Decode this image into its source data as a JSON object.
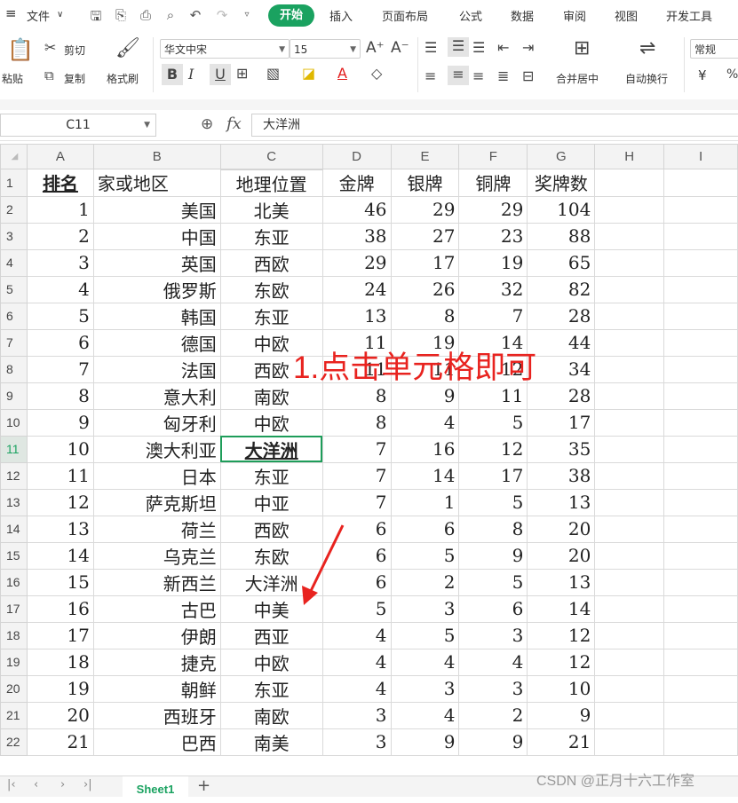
{
  "menubar": {
    "file_label": "文件",
    "tabs": [
      "开始",
      "插入",
      "页面布局",
      "公式",
      "数据",
      "审阅",
      "视图",
      "开发工具"
    ]
  },
  "ribbon": {
    "paste": "粘贴",
    "cut": "剪切",
    "copy": "复制",
    "format_painter": "格式刷",
    "font_name": "华文中宋",
    "font_size": "15",
    "merge_center": "合并居中",
    "wrap_text": "自动换行",
    "number_format": "常规",
    "currency_symbol": "¥"
  },
  "formula_bar": {
    "cell_ref": "C11",
    "fx_label": "fx",
    "value": "大洋洲"
  },
  "grid": {
    "columns": [
      "A",
      "B",
      "C",
      "D",
      "E",
      "F",
      "G",
      "H",
      "I"
    ],
    "header_row": [
      "排名",
      "家或地区",
      "地理位置",
      "金牌",
      "银牌",
      "铜牌",
      "奖牌数"
    ],
    "rows": [
      [
        "1",
        "美国",
        "北美",
        "46",
        "29",
        "29",
        "104"
      ],
      [
        "2",
        "中国",
        "东亚",
        "38",
        "27",
        "23",
        "88"
      ],
      [
        "3",
        "英国",
        "西欧",
        "29",
        "17",
        "19",
        "65"
      ],
      [
        "4",
        "俄罗斯",
        "东欧",
        "24",
        "26",
        "32",
        "82"
      ],
      [
        "5",
        "韩国",
        "东亚",
        "13",
        "8",
        "7",
        "28"
      ],
      [
        "6",
        "德国",
        "中欧",
        "11",
        "19",
        "14",
        "44"
      ],
      [
        "7",
        "法国",
        "西欧",
        "11",
        "11",
        "12",
        "34"
      ],
      [
        "8",
        "意大利",
        "南欧",
        "8",
        "9",
        "11",
        "28"
      ],
      [
        "9",
        "匈牙利",
        "中欧",
        "8",
        "4",
        "5",
        "17"
      ],
      [
        "10",
        "澳大利亚",
        "大洋洲",
        "7",
        "16",
        "12",
        "35"
      ],
      [
        "11",
        "日本",
        "东亚",
        "7",
        "14",
        "17",
        "38"
      ],
      [
        "12",
        "萨克斯坦",
        "中亚",
        "7",
        "1",
        "5",
        "13"
      ],
      [
        "13",
        "荷兰",
        "西欧",
        "6",
        "6",
        "8",
        "20"
      ],
      [
        "14",
        "乌克兰",
        "东欧",
        "6",
        "5",
        "9",
        "20"
      ],
      [
        "15",
        "新西兰",
        "大洋洲",
        "6",
        "2",
        "5",
        "13"
      ],
      [
        "16",
        "古巴",
        "中美",
        "5",
        "3",
        "6",
        "14"
      ],
      [
        "17",
        "伊朗",
        "西亚",
        "4",
        "5",
        "3",
        "12"
      ],
      [
        "18",
        "捷克",
        "中欧",
        "4",
        "4",
        "4",
        "12"
      ],
      [
        "19",
        "朝鲜",
        "东亚",
        "4",
        "3",
        "3",
        "10"
      ],
      [
        "20",
        "西班牙",
        "南欧",
        "3",
        "4",
        "2",
        "9"
      ],
      [
        "21",
        "巴西",
        "南美",
        "3",
        "9",
        "9",
        "21"
      ]
    ],
    "active_cell": "C11"
  },
  "annotation": "1.点击单元格即可",
  "statusbar": {
    "sheet_name": "Sheet1",
    "add_sheet": "+"
  },
  "watermark": "CSDN @正月十六工作室",
  "colors": {
    "accent_green": "#1aa260",
    "annotation_red": "#e8231f"
  }
}
